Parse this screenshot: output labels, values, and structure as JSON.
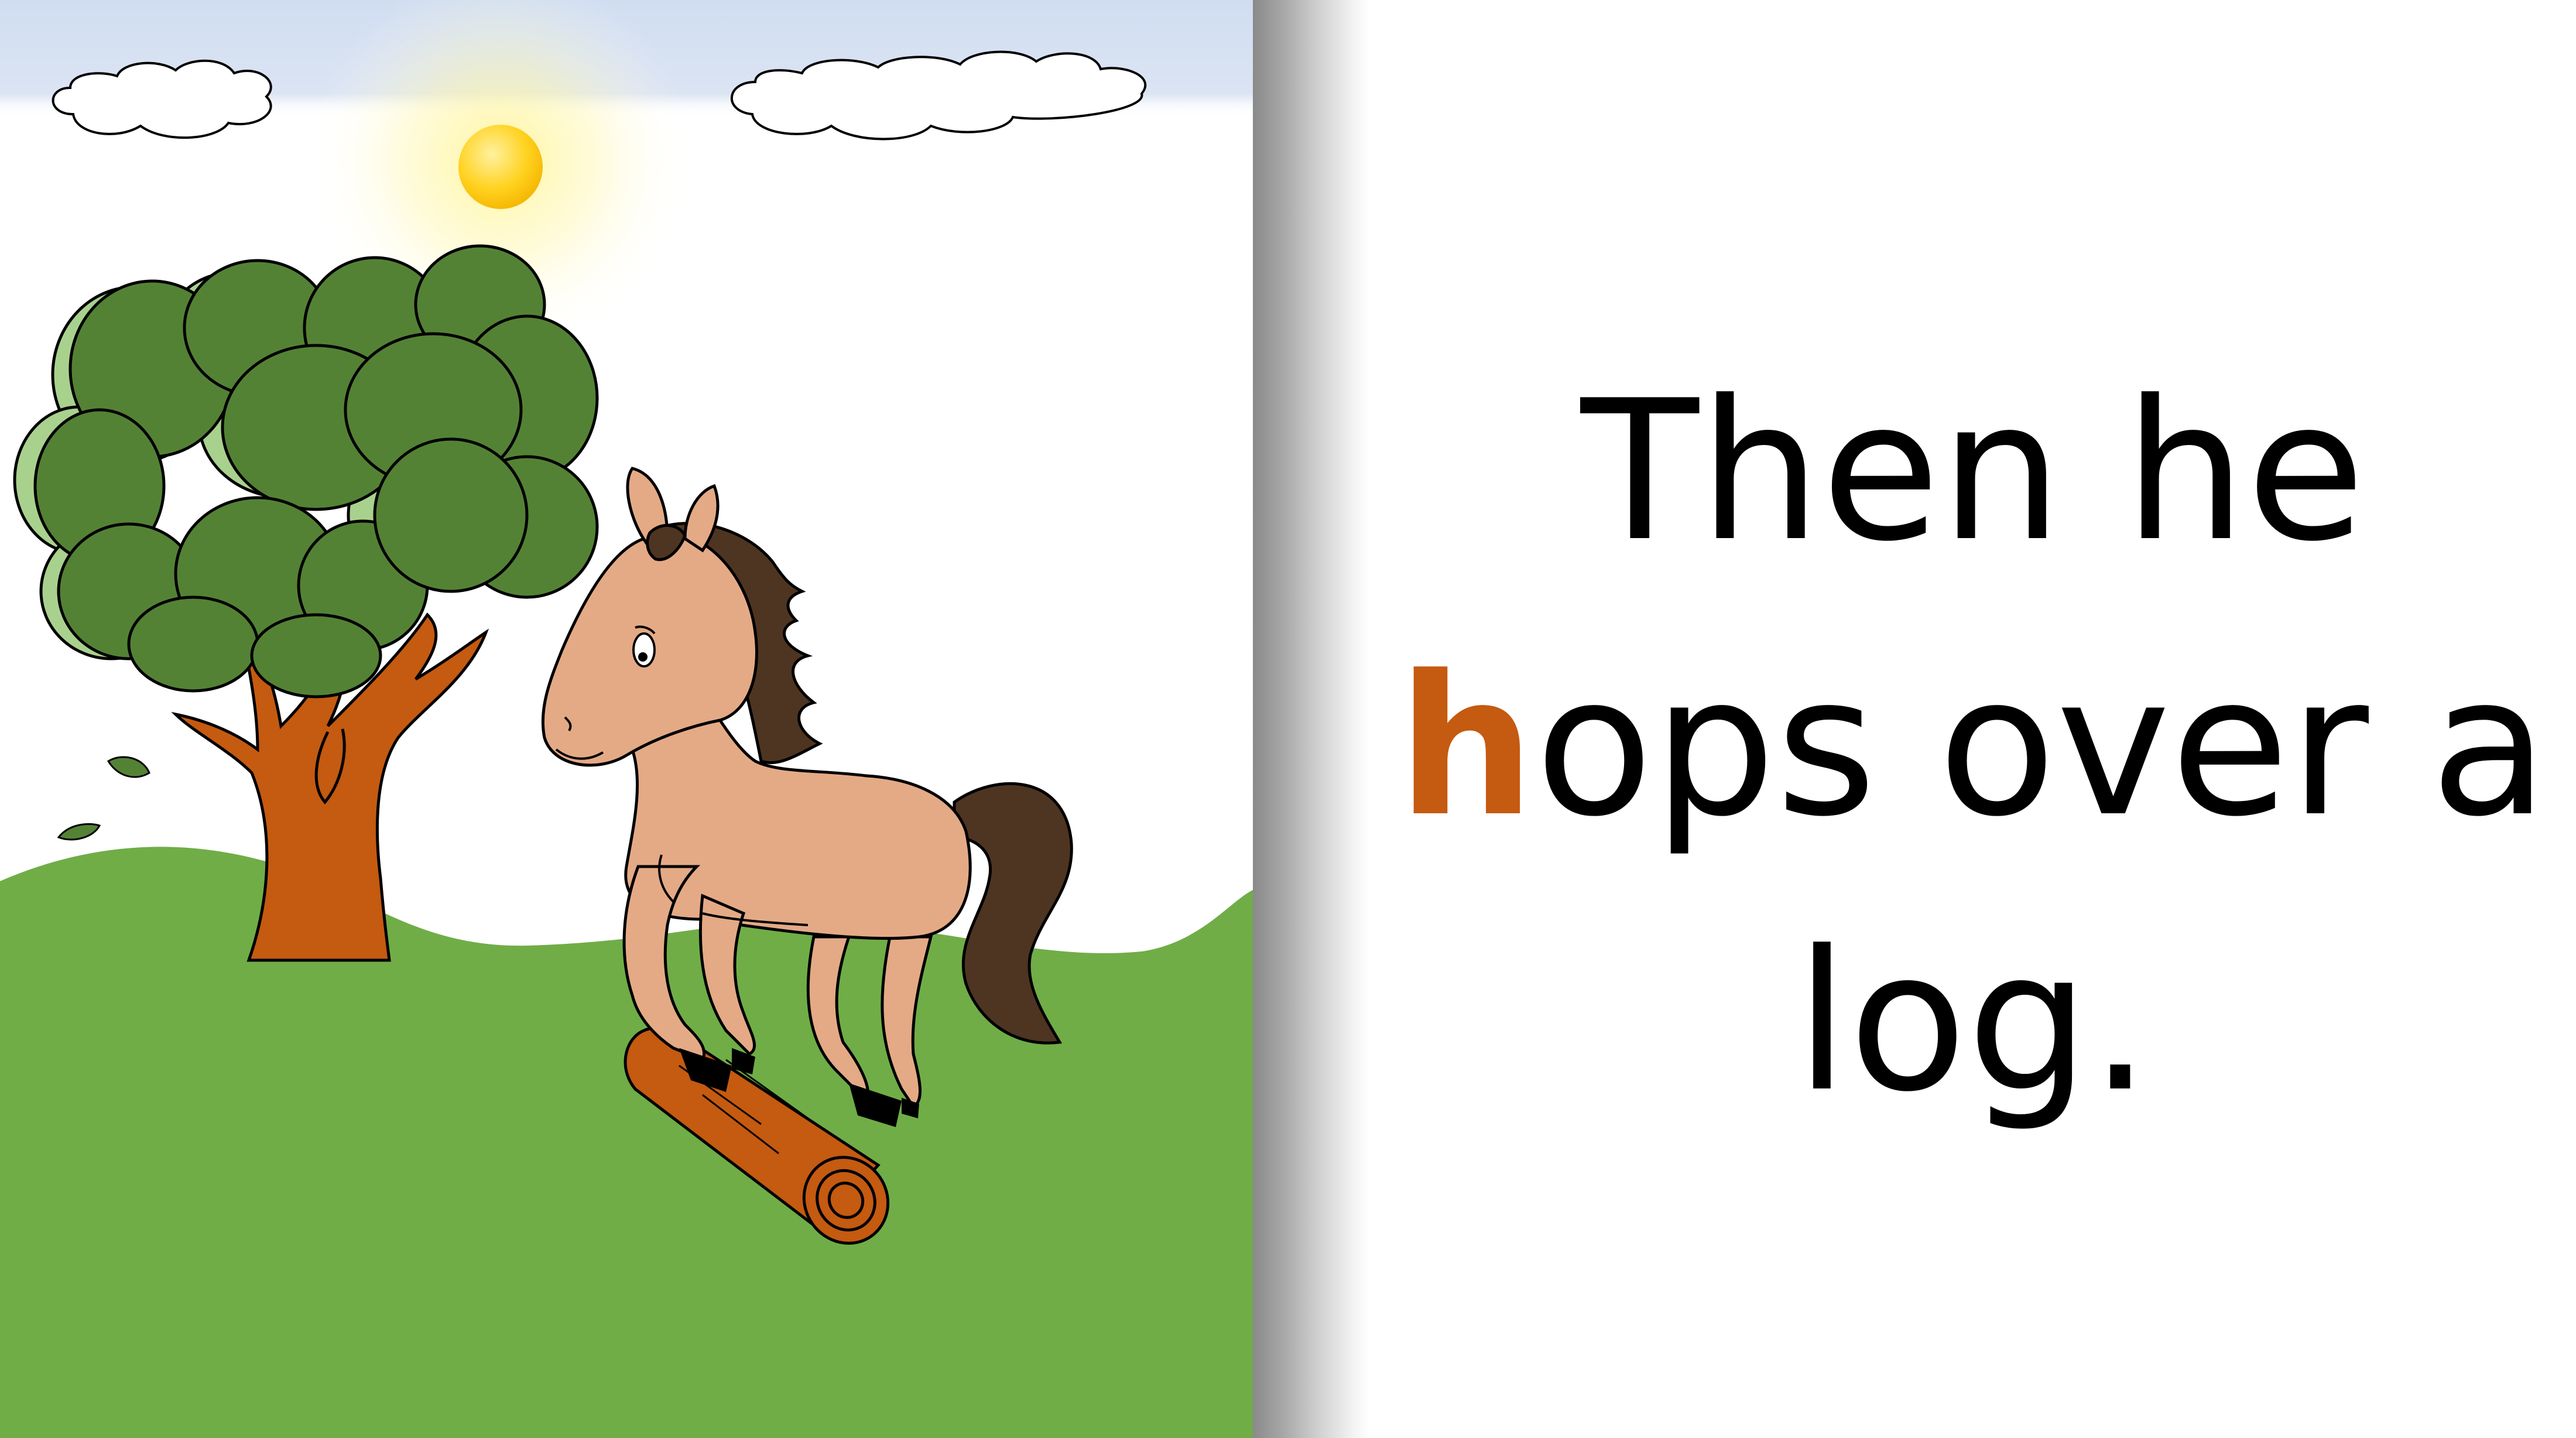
{
  "story": {
    "line1": "Then he",
    "highlight_letter": "h",
    "line2_rest": "ops over a",
    "line3": "log."
  },
  "colors": {
    "highlight": "#c55a11",
    "sky_band": "#dae3f3",
    "grass": "#70ad47",
    "foliage": "#548235",
    "foliage_light": "#a9d18e",
    "trunk": "#c55a11",
    "horse_body": "#e4aa86",
    "horse_mane": "#4e3521",
    "sun": "#ffd966"
  },
  "illustration": {
    "elements": [
      "sky",
      "clouds",
      "sun",
      "tree",
      "grass",
      "horse",
      "log",
      "falling-leaves"
    ]
  }
}
